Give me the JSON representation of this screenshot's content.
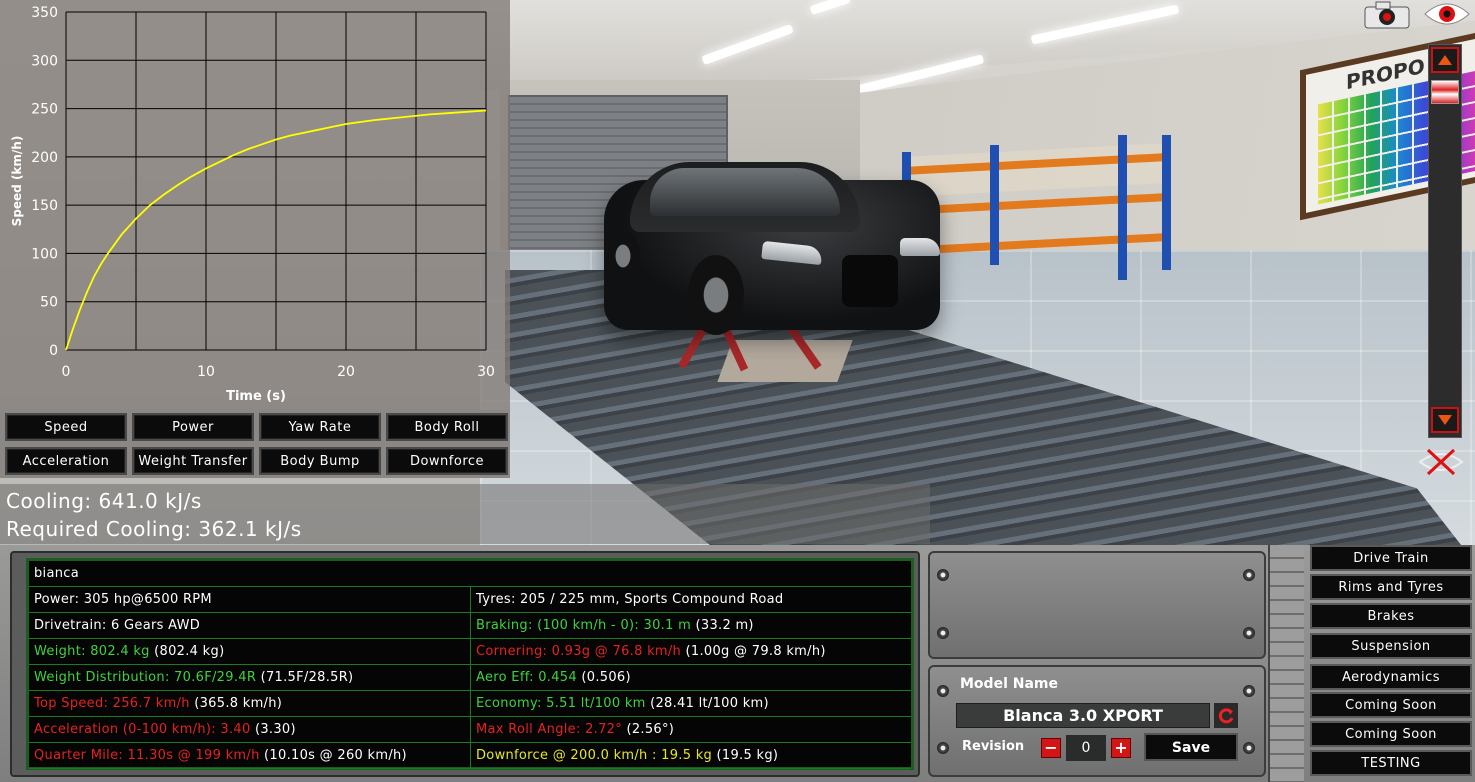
{
  "chart_data": {
    "type": "line",
    "xlabel": "Time (s)",
    "ylabel": "Speed (km/h)",
    "xlim": [
      0,
      30
    ],
    "ylim": [
      0,
      350
    ],
    "xticks": [
      "0",
      "10",
      "20",
      "30"
    ],
    "yticks": [
      "0",
      "50",
      "100",
      "150",
      "200",
      "250",
      "300",
      "350"
    ],
    "grid": true,
    "color": "#ffff00",
    "x": [
      0,
      0.5,
      1,
      1.5,
      2,
      2.5,
      3,
      4,
      5,
      6,
      7,
      8,
      9,
      10,
      11,
      12,
      13,
      14,
      15,
      16,
      17,
      18,
      19,
      20,
      22,
      24,
      26,
      28,
      30
    ],
    "y": [
      0,
      22,
      42,
      60,
      76,
      89,
      100,
      120,
      136,
      150,
      161,
      171,
      180,
      188,
      195,
      202,
      208,
      213,
      218,
      222,
      225,
      228,
      231,
      234,
      238,
      241,
      244,
      246,
      248
    ]
  },
  "tabs": {
    "row1": [
      "Speed",
      "Power",
      "Yaw Rate",
      "Body Roll"
    ],
    "row2": [
      "Acceleration",
      "Weight Transfer",
      "Body Bump",
      "Downforce"
    ]
  },
  "cooling": {
    "cooling": "Cooling: 641.0 kJ/s",
    "required": "Required Cooling: 362.1 kJ/s"
  },
  "stats": {
    "name": "bianca",
    "rows": [
      {
        "left": [
          {
            "t": "Power: 305 hp@6500 RPM",
            "c": "white"
          }
        ],
        "right": [
          {
            "t": "Tyres: 205 / 225 mm, Sports Compound Road",
            "c": "white"
          }
        ]
      },
      {
        "left": [
          {
            "t": "Drivetrain: 6 Gears AWD",
            "c": "white"
          }
        ],
        "right": [
          {
            "t": "Braking: (100 km/h - 0): 30.1 m",
            "c": "green"
          },
          {
            "t": " (33.2 m)",
            "c": "white"
          }
        ]
      },
      {
        "left": [
          {
            "t": "Weight: 802.4 kg",
            "c": "green"
          },
          {
            "t": " (802.4 kg)",
            "c": "white"
          }
        ],
        "right": [
          {
            "t": "Cornering: 0.93g @ 76.8 km/h",
            "c": "red"
          },
          {
            "t": " (1.00g @ 79.8 km/h)",
            "c": "white"
          }
        ]
      },
      {
        "left": [
          {
            "t": "Weight Distribution: 70.6F/29.4R",
            "c": "green"
          },
          {
            "t": " (71.5F/28.5R)",
            "c": "white"
          }
        ],
        "right": [
          {
            "t": "Aero Eff: 0.454",
            "c": "green"
          },
          {
            "t": " (0.506)",
            "c": "white"
          }
        ]
      },
      {
        "left": [
          {
            "t": "Top Speed: 256.7 km/h",
            "c": "red"
          },
          {
            "t": " (365.8 km/h)",
            "c": "white"
          }
        ],
        "right": [
          {
            "t": "Economy: 5.51 lt/100 km",
            "c": "green"
          },
          {
            "t": " (28.41 lt/100 km)",
            "c": "white"
          }
        ]
      },
      {
        "left": [
          {
            "t": "Acceleration (0-100 km/h): 3.40",
            "c": "red"
          },
          {
            "t": " (3.30)",
            "c": "white"
          }
        ],
        "right": [
          {
            "t": "Max Roll Angle: 2.72°",
            "c": "red"
          },
          {
            "t": " (2.56°)",
            "c": "white"
          }
        ]
      },
      {
        "left": [
          {
            "t": "Quarter Mile: 11.30s @ 199 km/h",
            "c": "red"
          },
          {
            "t": " (10.10s @ 260 km/h)",
            "c": "white"
          }
        ],
        "right": [
          {
            "t": "Downforce @ 200.0 km/h : 19.5 kg",
            "c": "yellow"
          },
          {
            "t": " (19.5 kg)",
            "c": "white"
          }
        ]
      }
    ]
  },
  "model": {
    "label": "Model Name",
    "value": "Blanca 3.0  XPORT",
    "revision_label": "Revision",
    "revision_value": "0",
    "minus": "−",
    "plus": "+",
    "save": "Save"
  },
  "menu": [
    "Drive Train",
    "Rims and Tyres",
    "Brakes",
    "Suspension",
    "Aerodynamics",
    "Coming Soon",
    "Coming Soon",
    "TESTING"
  ],
  "poster": {
    "title": "PROPO"
  },
  "icons": {
    "camera": "camera-icon",
    "eye": "eye-icon",
    "hide": "hide-icon",
    "scroll_up": "chevron-up-icon",
    "scroll_down": "chevron-down-icon",
    "refresh": "refresh-icon"
  }
}
